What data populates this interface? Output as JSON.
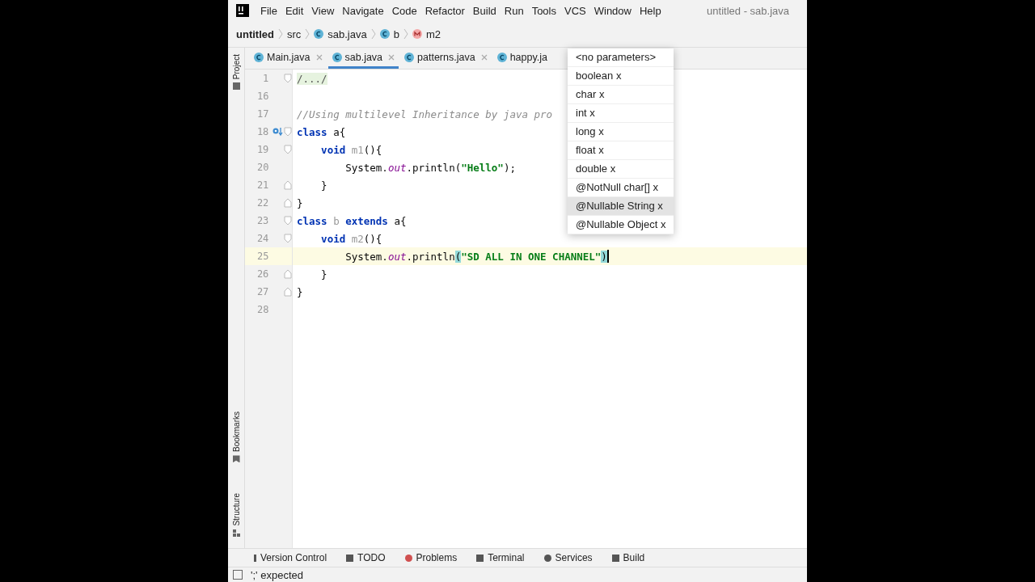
{
  "menu": [
    "File",
    "Edit",
    "View",
    "Navigate",
    "Code",
    "Refactor",
    "Build",
    "Run",
    "Tools",
    "VCS",
    "Window",
    "Help"
  ],
  "window": {
    "title": "untitled - sab.java"
  },
  "breadcrumbs": [
    {
      "label": "untitled",
      "kind": "project"
    },
    {
      "label": "src",
      "kind": "folder"
    },
    {
      "label": "sab.java",
      "kind": "class"
    },
    {
      "label": "b",
      "kind": "class"
    },
    {
      "label": "m2",
      "kind": "method"
    }
  ],
  "side_tools": [
    {
      "label": "Project",
      "kind": "folder"
    },
    {
      "label": "Bookmarks",
      "kind": "bookmark"
    },
    {
      "label": "Structure",
      "kind": "structure"
    }
  ],
  "tabs": [
    {
      "label": "Main.java",
      "selected": false,
      "closable": true
    },
    {
      "label": "sab.java",
      "selected": true,
      "closable": true
    },
    {
      "label": "patterns.java",
      "selected": false,
      "closable": true
    },
    {
      "label": "happy.ja",
      "selected": false,
      "closable": false
    }
  ],
  "code": [
    {
      "number": "1",
      "current": false,
      "fold_start": true,
      "fold_end": false,
      "marker": false,
      "tokens": [
        {
          "kind": "folded",
          "text": "/.../"
        }
      ]
    },
    {
      "number": "16",
      "current": false,
      "fold_start": false,
      "fold_end": false,
      "marker": false
    },
    {
      "number": "17",
      "current": false,
      "fold_start": false,
      "fold_end": false,
      "marker": false,
      "tokens": [
        {
          "kind": "comment",
          "text": "//Using multilevel Inheritance by java pro"
        }
      ]
    },
    {
      "number": "18",
      "current": false,
      "fold_start": true,
      "fold_end": false,
      "marker": true,
      "tokens": [
        {
          "kind": "keyword",
          "text": "class "
        },
        {
          "kind": "plain",
          "text": "a{"
        }
      ]
    },
    {
      "number": "19",
      "current": false,
      "fold_start": true,
      "fold_end": false,
      "marker": false,
      "tokens": [
        {
          "kind": "keyword",
          "text": "    void "
        },
        {
          "kind": "unused",
          "text": "m1"
        },
        {
          "kind": "plain",
          "text": "(){"
        }
      ]
    },
    {
      "number": "20",
      "current": false,
      "fold_start": false,
      "fold_end": false,
      "marker": false,
      "tokens": [
        {
          "kind": "plain",
          "text": "        System."
        },
        {
          "kind": "field",
          "text": "out"
        },
        {
          "kind": "plain",
          "text": ".println("
        },
        {
          "kind": "string",
          "text": "\"Hello\""
        },
        {
          "kind": "plain",
          "text": ");"
        }
      ]
    },
    {
      "number": "21",
      "current": false,
      "fold_start": false,
      "fold_end": true,
      "marker": false,
      "tokens": [
        {
          "kind": "plain",
          "text": "    }"
        }
      ]
    },
    {
      "number": "22",
      "current": false,
      "fold_start": false,
      "fold_end": true,
      "marker": false,
      "tokens": [
        {
          "kind": "plain",
          "text": "}"
        }
      ]
    },
    {
      "number": "23",
      "current": false,
      "fold_start": true,
      "fold_end": false,
      "marker": false,
      "tokens": [
        {
          "kind": "keyword",
          "text": "class "
        },
        {
          "kind": "unused",
          "text": "b "
        },
        {
          "kind": "keyword",
          "text": "extends "
        },
        {
          "kind": "plain",
          "text": "a{"
        }
      ]
    },
    {
      "number": "24",
      "current": false,
      "fold_start": true,
      "fold_end": false,
      "marker": false,
      "tokens": [
        {
          "kind": "keyword",
          "text": "    void "
        },
        {
          "kind": "unused",
          "text": "m2"
        },
        {
          "kind": "plain",
          "text": "(){"
        }
      ]
    },
    {
      "number": "25",
      "current": true,
      "fold_start": false,
      "fold_end": false,
      "marker": false,
      "tokens": [
        {
          "kind": "plain",
          "text": "        System."
        },
        {
          "kind": "field",
          "text": "out"
        },
        {
          "kind": "plain",
          "text": ".println"
        },
        {
          "kind": "match",
          "text": "("
        },
        {
          "kind": "string",
          "text": "\"SD ALL IN ONE CHANNEL\""
        },
        {
          "kind": "match",
          "text": ")"
        }
      ]
    },
    {
      "number": "26",
      "current": false,
      "fold_start": false,
      "fold_end": true,
      "marker": false,
      "tokens": [
        {
          "kind": "plain",
          "text": "    }"
        }
      ]
    },
    {
      "number": "27",
      "current": false,
      "fold_start": false,
      "fold_end": true,
      "marker": false,
      "tokens": [
        {
          "kind": "plain",
          "text": "}"
        }
      ]
    },
    {
      "number": "28",
      "current": false,
      "fold_start": false,
      "fold_end": false,
      "marker": false
    }
  ],
  "parameter_popup": [
    {
      "label": "<no parameters>",
      "selected": false
    },
    {
      "label": "boolean x",
      "selected": false
    },
    {
      "label": "char x",
      "selected": false
    },
    {
      "label": "int x",
      "selected": false
    },
    {
      "label": "long x",
      "selected": false
    },
    {
      "label": "float x",
      "selected": false
    },
    {
      "label": "double x",
      "selected": false
    },
    {
      "label": "@NotNull char[] x",
      "selected": false
    },
    {
      "label": "@Nullable String x",
      "selected": true
    },
    {
      "label": "@Nullable Object x",
      "selected": false
    }
  ],
  "tool_windows": [
    {
      "label": "Version Control",
      "kind": "vcs"
    },
    {
      "label": "TODO",
      "kind": "todo"
    },
    {
      "label": "Problems",
      "kind": "problems"
    },
    {
      "label": "Terminal",
      "kind": "terminal"
    },
    {
      "label": "Services",
      "kind": "services"
    },
    {
      "label": "Build",
      "kind": "build"
    }
  ],
  "status_bar": {
    "message": "';' expected"
  }
}
